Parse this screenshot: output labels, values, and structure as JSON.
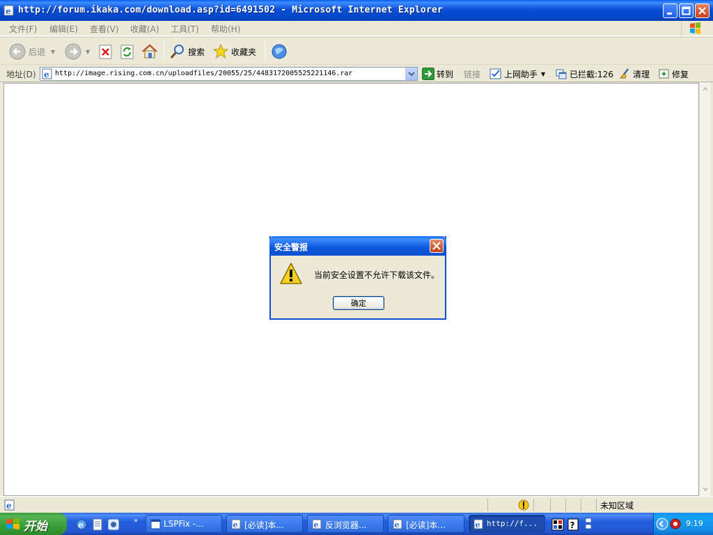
{
  "window": {
    "title": "http://forum.ikaka.com/download.asp?id=6491502 - Microsoft Internet Explorer"
  },
  "menu": {
    "items": [
      "文件(F)",
      "编辑(E)",
      "查看(V)",
      "收藏(A)",
      "工具(T)",
      "帮助(H)"
    ]
  },
  "toolbar": {
    "back_label": "后退",
    "search_label": "搜索",
    "favorites_label": "收藏夹"
  },
  "address": {
    "label": "地址(D)",
    "url": "http://image.rising.com.cn/uploadfiles/20055/25/4483172005525221146.rar",
    "go_label": "转到",
    "links_label": "链接",
    "assistant_label": "上网助手",
    "blocked_label": "已拦截:126",
    "clean_label": "清理",
    "repair_label": "修复"
  },
  "dialog": {
    "title": "安全警报",
    "message": "当前安全设置不允许下载该文件。",
    "ok_label": "确定"
  },
  "status": {
    "zone": "未知区域"
  },
  "taskbar": {
    "start_label": "开始",
    "tasks": [
      {
        "label": "LSPFix -..."
      },
      {
        "label": "[必读]本..."
      },
      {
        "label": "反浏览器..."
      },
      {
        "label": "[必读]本..."
      },
      {
        "label": "http://f..."
      }
    ],
    "clock": "9:19"
  },
  "colors": {
    "titlebar_blue": "#0a4fd6",
    "taskbar_blue": "#245edb",
    "start_green": "#3b9f3a",
    "close_red": "#c9411b",
    "warning_yellow": "#f8d01e"
  }
}
